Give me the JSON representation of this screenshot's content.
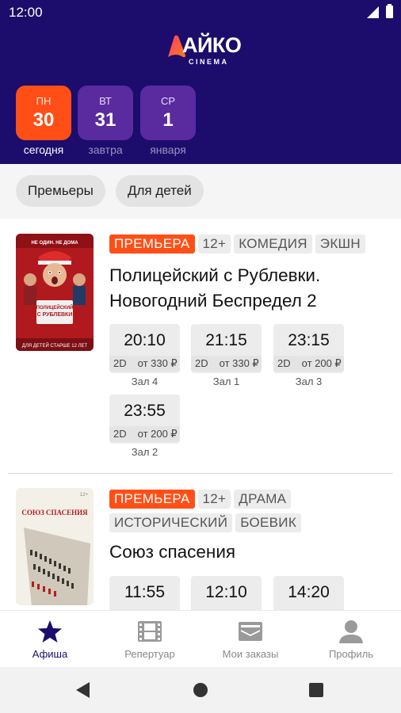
{
  "status_bar": {
    "time": "12:00"
  },
  "brand": {
    "name": "АЙКО",
    "subtitle": "CINEMA",
    "accent_color": "#ff4f17",
    "header_color": "#1c0c6b"
  },
  "days": [
    {
      "abbr": "ПН",
      "num": "30",
      "sub": "сегодня",
      "active": true
    },
    {
      "abbr": "ВТ",
      "num": "31",
      "sub": "завтра",
      "active": false
    },
    {
      "abbr": "СР",
      "num": "1",
      "sub": "января",
      "active": false
    }
  ],
  "filters": [
    "Премьеры",
    "Для детей"
  ],
  "movies": [
    {
      "badges": [
        "ПРЕМЬЕРА",
        "12+",
        "КОМЕДИЯ",
        "ЭКШН"
      ],
      "title": "Полицейский с Рублевки. Новогодний Беспредел 2",
      "poster": {
        "tagline": "НЕ ОДИН. НЕ ДОМА",
        "name": "ПОЛИЦЕЙСКИЙ С РУБЛЕВКИ",
        "footer": "ДЛЯ ДЕТЕЙ СТАРШЕ 12 ЛЕТ"
      },
      "sessions": [
        {
          "time": "20:10",
          "format": "2D",
          "price": "от 330 ₽",
          "hall": "Зал 4"
        },
        {
          "time": "21:15",
          "format": "2D",
          "price": "от 330 ₽",
          "hall": "Зал 1"
        },
        {
          "time": "23:15",
          "format": "2D",
          "price": "от 200 ₽",
          "hall": "Зал 3"
        },
        {
          "time": "23:55",
          "format": "2D",
          "price": "от 200 ₽",
          "hall": "Зал 2"
        }
      ]
    },
    {
      "badges": [
        "ПРЕМЬЕРА",
        "12+",
        "ДРАМА",
        "ИСТОРИЧЕСКИЙ",
        "БОЕВИК"
      ],
      "title": "Союз спасения",
      "poster": {
        "name": "СОЮЗ СПАСЕНИЯ",
        "rating": "12+"
      },
      "sessions": [
        {
          "time": "11:55"
        },
        {
          "time": "12:10"
        },
        {
          "time": "14:20"
        }
      ]
    }
  ],
  "bottom_nav": [
    {
      "label": "Афиша",
      "icon": "star-icon",
      "active": true
    },
    {
      "label": "Репертуар",
      "icon": "film-icon",
      "active": false
    },
    {
      "label": "Мои заказы",
      "icon": "ticket-icon",
      "active": false
    },
    {
      "label": "Профиль",
      "icon": "profile-icon",
      "active": false
    }
  ]
}
